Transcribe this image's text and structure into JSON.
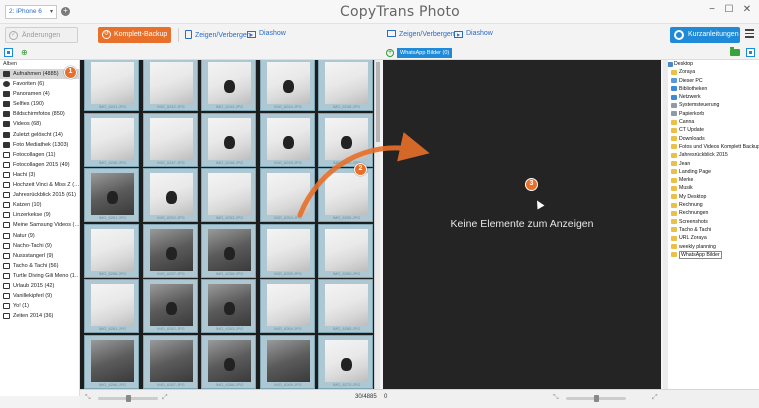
{
  "titlebar": {
    "device": "2: iPhone 6",
    "add_device": "+",
    "app_title": "CopyTrans Photo",
    "minimize": "−",
    "maximize": "☐",
    "close": "✕"
  },
  "toolbar": {
    "save_label": "Änderungen speichern",
    "backup_label": "Komplett-Backup",
    "show_hide_label": "Zeigen/Verbergen",
    "slideshow_label": "Diashow",
    "show_hide_label_right": "Zeigen/Verbergen",
    "slideshow_label_right": "Diashow",
    "guides_label": "Kurzanleitungen"
  },
  "albums": {
    "title": "Alben",
    "items": [
      {
        "label": "Aufnahmen (4885)",
        "icon": "camera-icon",
        "selected": true
      },
      {
        "label": "Favoriten (6)",
        "icon": "heart-icon"
      },
      {
        "label": "Panoramen (4)",
        "icon": "panorama-icon"
      },
      {
        "label": "Selfies (190)",
        "icon": "selfie-icon"
      },
      {
        "label": "Bildschirmfotos (850)",
        "icon": "screenshot-icon"
      },
      {
        "label": "Videos (68)",
        "icon": "video-icon"
      },
      {
        "label": "Zuletzt gelöscht (14)",
        "icon": "trash-icon"
      },
      {
        "label": "Foto Mediathek (1303)",
        "icon": "library-icon"
      },
      {
        "label": "Fotocollagen (11)",
        "icon": "album-icon"
      },
      {
        "label": "Fotocollagen 2015 (49)",
        "icon": "album-icon"
      },
      {
        "label": "Hachi (3)",
        "icon": "album-icon"
      },
      {
        "label": "Hochzeit Vinci & Miss Z (…",
        "icon": "album-icon"
      },
      {
        "label": "Jahresrückblick 2015 (61)",
        "icon": "album-icon"
      },
      {
        "label": "Katzen (10)",
        "icon": "album-icon"
      },
      {
        "label": "Linzerkekse (9)",
        "icon": "album-icon"
      },
      {
        "label": "Meine Samsung Videos (…",
        "icon": "album-icon"
      },
      {
        "label": "Natur (9)",
        "icon": "album-icon"
      },
      {
        "label": "Nacho-Tachi (9)",
        "icon": "album-icon"
      },
      {
        "label": "Nussstangerl (9)",
        "icon": "album-icon"
      },
      {
        "label": "Tacho & Tachi (56)",
        "icon": "album-icon"
      },
      {
        "label": "Turtle Diving Gili Meno (1…",
        "icon": "album-icon"
      },
      {
        "label": "Urlaub 2015 (42)",
        "icon": "album-icon"
      },
      {
        "label": "Vanillekipferl (9)",
        "icon": "album-icon"
      },
      {
        "label": "Yo! (1)",
        "icon": "album-icon"
      },
      {
        "label": "Zeiten 2014 (36)",
        "icon": "album-icon"
      }
    ]
  },
  "photos": {
    "captions": [
      "IMG_6241.JPG",
      "IMG_6242.JPG",
      "IMG_6243.JPG",
      "IMG_6244.JPG",
      "IMG_6245.JPG",
      "IMG_6246.JPG",
      "IMG_6247.JPG",
      "IMG_6248.JPG",
      "IMG_6249.JPG",
      "IMG_6250.JPG",
      "IMG_6251.JPG",
      "IMG_6252.JPG",
      "IMG_6253.JPG",
      "IMG_6254.JPG",
      "IMG_6255.JPG",
      "IMG_6256.JPG",
      "IMG_6257.JPG",
      "IMG_6258.JPG",
      "IMG_6259.JPG",
      "IMG_6260.JPG",
      "IMG_6261.JPG",
      "IMG_6262.JPG",
      "IMG_6263.JPG",
      "IMG_6264.JPG",
      "IMG_6265.JPG",
      "IMG_6266.JPG",
      "IMG_6267.JPG",
      "IMG_6268.JPG",
      "IMG_6269.JPG",
      "IMG_6270.JPG"
    ],
    "count_label": "30/4885"
  },
  "dest": {
    "tab_label": "WhatsApp Bilder (0)",
    "empty_message": "Keine Elemente zum Anzeigen",
    "count_label": "0"
  },
  "tree": {
    "root": "Desktop",
    "items": [
      {
        "label": "Zoraya",
        "icon": "folder-icon"
      },
      {
        "label": "Dieser PC",
        "icon": "pc-icon"
      },
      {
        "label": "Bibliotheken",
        "icon": "library-icon"
      },
      {
        "label": "Netzwerk",
        "icon": "network-icon"
      },
      {
        "label": "Systemsteuerung",
        "icon": "control-panel-icon"
      },
      {
        "label": "Papierkorb",
        "icon": "recycle-icon"
      },
      {
        "label": "Canna",
        "icon": "folder-icon"
      },
      {
        "label": "CT Update",
        "icon": "folder-icon"
      },
      {
        "label": "Downloads",
        "icon": "folder-icon"
      },
      {
        "label": "Fotos und Videos Komplett Backup",
        "icon": "folder-icon"
      },
      {
        "label": "Jahresrückblick 2015",
        "icon": "folder-icon"
      },
      {
        "label": "Jean",
        "icon": "folder-icon"
      },
      {
        "label": "Landing Page",
        "icon": "folder-icon"
      },
      {
        "label": "Merke",
        "icon": "folder-icon"
      },
      {
        "label": "Musik",
        "icon": "folder-icon"
      },
      {
        "label": "My Desktop",
        "icon": "folder-icon"
      },
      {
        "label": "Rechnung",
        "icon": "folder-icon"
      },
      {
        "label": "Rechnungen",
        "icon": "folder-icon"
      },
      {
        "label": "Screenshots",
        "icon": "folder-icon"
      },
      {
        "label": "Tacho & Tachi",
        "icon": "folder-icon"
      },
      {
        "label": "URL Zoraya",
        "icon": "folder-icon"
      },
      {
        "label": "weekly planning",
        "icon": "folder-icon"
      },
      {
        "label": "WhatsApp Bilder",
        "icon": "folder-icon",
        "selected": true
      }
    ]
  },
  "annotations": {
    "step1": "1",
    "step2": "2",
    "step3": "3"
  },
  "colors": {
    "accent_orange": "#e8702a",
    "accent_blue": "#1f8ad8"
  }
}
